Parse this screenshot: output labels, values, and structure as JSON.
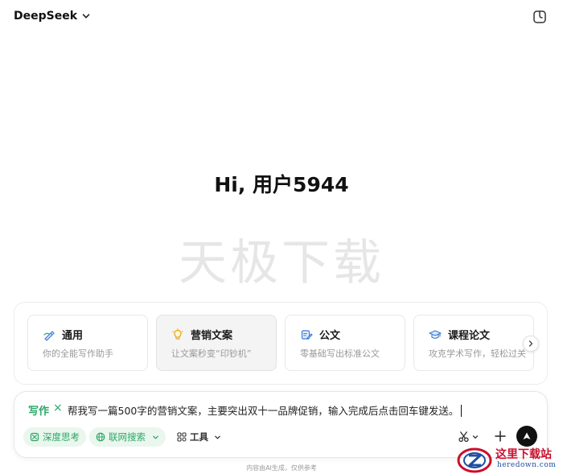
{
  "header": {
    "app_name": "DeepSeek"
  },
  "greeting": "Hi, 用户5944",
  "watermark": "天极下载",
  "cards": [
    {
      "title": "通用",
      "desc": "你的全能写作助手",
      "icon": "pen-icon"
    },
    {
      "title": "营销文案",
      "desc": "让文案秒变“印钞机”",
      "icon": "lightbulb-icon"
    },
    {
      "title": "公文",
      "desc": "零基础写出标准公文",
      "icon": "document-pen-icon"
    },
    {
      "title": "课程论文",
      "desc": "攻克学术写作，轻松过关",
      "icon": "graduation-cap-icon"
    }
  ],
  "input": {
    "mode": "写作",
    "mode_close": "×",
    "text": "帮我写一篇500字的营销文案，主要突出双十一品牌促销，输入完成后点击回车键发送。"
  },
  "toolbar": {
    "deep_think": "深度思考",
    "web_search": "联网搜索",
    "tools": "工具"
  },
  "disclaimer": "内容由AI生成，仅供参考",
  "logo": {
    "cn": "这里下载站",
    "en": "heredown.com"
  },
  "colors": {
    "accent_green": "#2aa866",
    "send_button": "#111111",
    "logo_red": "#c8102e",
    "logo_blue": "#1f4fa3"
  }
}
